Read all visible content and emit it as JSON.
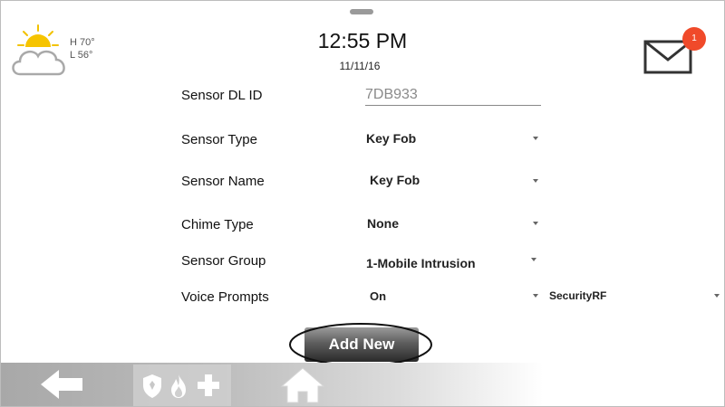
{
  "weather": {
    "icon": "partly-cloudy-icon",
    "high": "H 70°",
    "low": "L 56°"
  },
  "clock": {
    "time": "12:55 PM",
    "date": "11/11/16"
  },
  "messages": {
    "icon": "envelope-icon",
    "unread_count": "1",
    "badge_color": "#f04a2a"
  },
  "form": {
    "sensor_dl_id": {
      "label": "Sensor DL ID",
      "value": "7DB933"
    },
    "sensor_type": {
      "label": "Sensor Type",
      "value": "Key Fob"
    },
    "sensor_name": {
      "label": "Sensor Name",
      "value": "Key Fob"
    },
    "chime_type": {
      "label": "Chime Type",
      "value": "None"
    },
    "sensor_group": {
      "label": "Sensor Group",
      "value": "1-Mobile Intrusion"
    },
    "voice_prompts": {
      "label": "Voice Prompts",
      "value": "On"
    },
    "protocol": {
      "value": "SecurityRF"
    }
  },
  "actions": {
    "add_new": "Add New"
  },
  "bottom_nav": {
    "items": [
      {
        "icon": "back-arrow-icon"
      },
      {
        "icons": [
          "shield-icon",
          "fire-icon",
          "medical-cross-icon"
        ]
      },
      {
        "icon": "home-icon"
      }
    ]
  }
}
